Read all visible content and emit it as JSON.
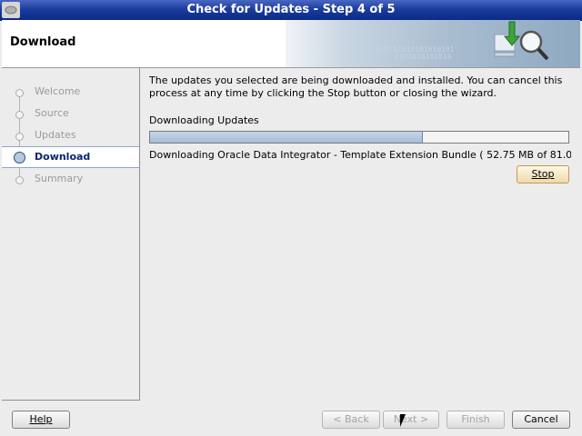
{
  "window": {
    "title": "Check for Updates - Step 4 of 5"
  },
  "header": {
    "heading": "Download"
  },
  "steps": [
    {
      "label": "Welcome",
      "state": "done"
    },
    {
      "label": "Source",
      "state": "done"
    },
    {
      "label": "Updates",
      "state": "done"
    },
    {
      "label": "Download",
      "state": "current"
    },
    {
      "label": "Summary",
      "state": "pending"
    }
  ],
  "main": {
    "intro": "The updates you selected are being downloaded and installed. You can cancel this process at any time by clicking the Stop button or closing the wizard.",
    "section_label": "Downloading Updates",
    "progress_fraction": 0.65,
    "status": "Downloading Oracle Data Integrator - Template Extension Bundle ( 52.75 MB of 81.0...",
    "stop_label": "Stop"
  },
  "footer": {
    "help_label": "Help",
    "back_label": "< Back",
    "next_label": "Next >",
    "finish_label": "Finish",
    "cancel_label": "Cancel"
  },
  "icons": {
    "banner": "download-magnifier-icon",
    "window": "system-menu-icon"
  }
}
